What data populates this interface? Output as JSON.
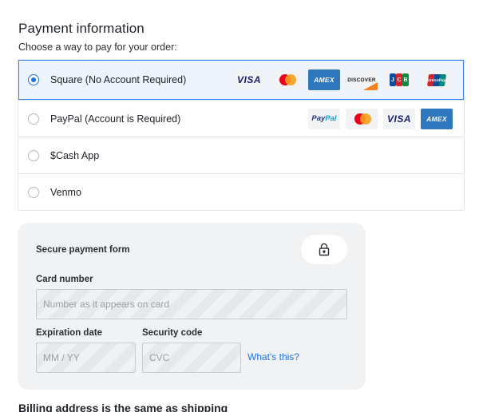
{
  "header": {
    "title": "Payment information",
    "subtitle": "Choose a way to pay for your order:"
  },
  "methods": [
    {
      "label": "Square (No Account Required)",
      "selected": true,
      "logos": [
        "VISA",
        "mastercard",
        "AMEX",
        "DISCOVER",
        "JCB",
        "UnionPay"
      ]
    },
    {
      "label": "PayPal (Account is Required)",
      "selected": false,
      "logos": [
        "PayPal",
        "mastercard",
        "VISA",
        "AMEX"
      ]
    },
    {
      "label": "$Cash App",
      "selected": false
    },
    {
      "label": "Venmo",
      "selected": false
    }
  ],
  "logo_text": {
    "visa": "VISA",
    "amex": "AMEX",
    "discover": "DISCOVER",
    "jcb_j": "J",
    "jcb_c": "C",
    "jcb_b": "B",
    "unionpay": "UnionPay",
    "paypal_pay": "Pay",
    "paypal_pal": "Pal"
  },
  "form": {
    "title": "Secure payment form",
    "card_label": "Card number",
    "card_placeholder": "Number as it appears on card",
    "exp_label": "Expiration date",
    "exp_placeholder": "MM / YY",
    "cvc_label": "Security code",
    "cvc_placeholder": "CVC",
    "whats_this": "What's this?"
  },
  "billing": {
    "text": "Billing address is the same as shipping"
  },
  "colors": {
    "accent": "#1a73e8",
    "selected_bg": "#eef4fd",
    "form_bg": "#f1f2f3"
  }
}
